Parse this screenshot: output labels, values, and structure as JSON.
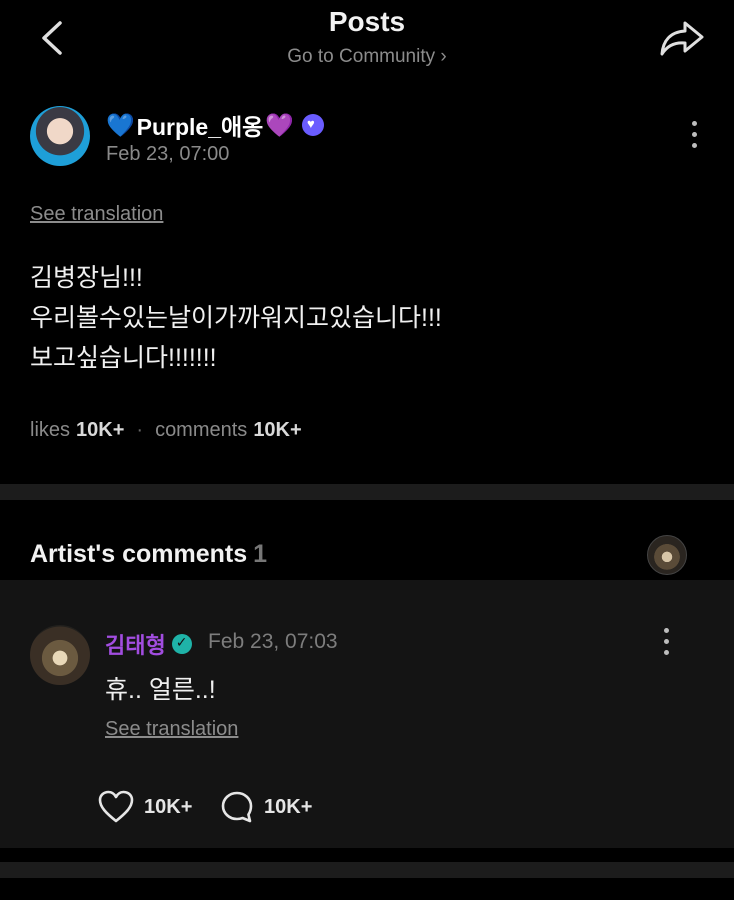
{
  "header": {
    "title": "Posts",
    "subtitle": "Go to Community",
    "subtitle_chevron": "›"
  },
  "post": {
    "author": {
      "name": "Purple_애옹",
      "prefix_emoji": "💙",
      "suffix_emoji": "💜"
    },
    "date": "Feb 23, 07:00",
    "see_translation": "See translation",
    "body_lines": [
      "김병장님!!!",
      "우리볼수있는날이가까워지고있습니다!!!",
      "보고싶습니다!!!!!!!"
    ],
    "likes_label": "likes",
    "likes_count": "10K+",
    "separator": "·",
    "comments_label": "comments",
    "comments_count": "10K+"
  },
  "artist_comments": {
    "heading": "Artist's comments",
    "count": "1",
    "comment": {
      "author": "김태형",
      "date": "Feb 23, 07:03",
      "text": "휴.. 얼른..!",
      "see_translation": "See translation",
      "likes": "10K+",
      "replies": "10K+"
    }
  },
  "colors": {
    "background": "#000000",
    "artist_name": "#a24de0",
    "verified_user": "#6a5cff",
    "verified_artist": "#1fb3a8",
    "muted_text": "#8c8c8c"
  },
  "icons": [
    "back-arrow-icon",
    "share-icon",
    "more-vertical-icon",
    "heart-icon",
    "comment-bubble-icon",
    "verified-icon"
  ]
}
